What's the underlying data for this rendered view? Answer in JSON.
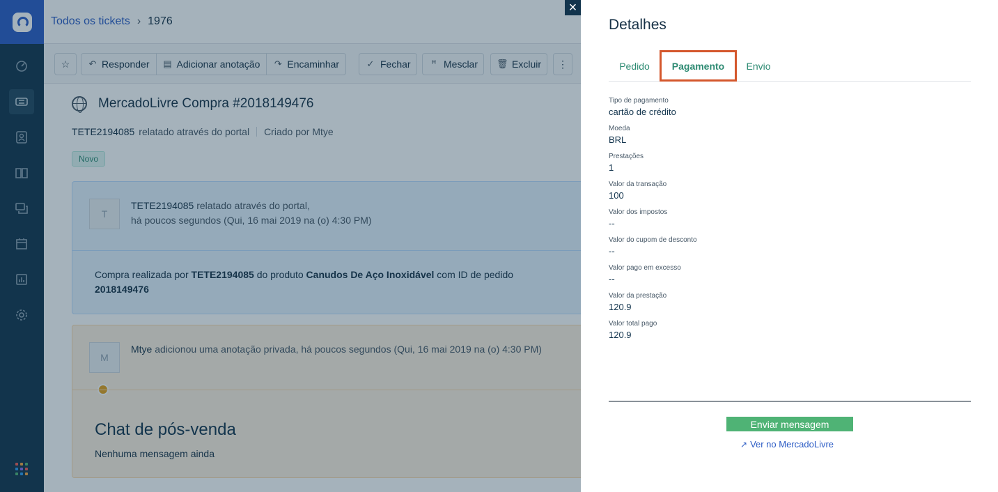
{
  "nav": {
    "items": [
      {
        "icon": "dashboard-icon"
      },
      {
        "icon": "tickets-icon",
        "active": true
      },
      {
        "icon": "contacts-icon"
      },
      {
        "icon": "solutions-icon"
      },
      {
        "icon": "forums-icon"
      },
      {
        "icon": "admin-icon"
      },
      {
        "icon": "reports-icon"
      },
      {
        "icon": "settings-icon"
      }
    ]
  },
  "header": {
    "breadcrumb_link": "Todos os tickets",
    "ticket_number": "1976"
  },
  "toolbar": {
    "star_icon": "star-icon",
    "reply": "Responder",
    "add_note": "Adicionar anotação",
    "forward": "Encaminhar",
    "close": "Fechar",
    "merge": "Mesclar",
    "delete": "Excluir",
    "more": "⋮"
  },
  "ticket": {
    "title": "MercadoLivre Compra #2018149476",
    "requester": "TETE2194085",
    "via": "relatado através do portal",
    "created_by": "Criado por Mtye",
    "status": "Novo"
  },
  "conversation1": {
    "avatar": "T",
    "name": "TETE2194085",
    "via": "relatado através do portal,",
    "time": "há poucos segundos (Qui, 16 mai 2019 na (o) 4:30 PM)",
    "body_prefix": "Compra realizada por ",
    "body_user": "TETE2194085",
    "body_mid": " do produto ",
    "body_product": "Canudos De Aço Inoxidável",
    "body_suffix": " com ID de pedido ",
    "body_order": "2018149476"
  },
  "conversation2": {
    "avatar": "M",
    "name": "Mtye",
    "action": "adicionou uma anotação privada, há poucos segundos (Qui, 16 mai 2019 na (o) 4:30 PM)",
    "chat_title": "Chat de pós-venda",
    "chat_sub": "Nenhuma mensagem ainda"
  },
  "panel": {
    "close": "×",
    "title": "Detalhes",
    "tabs": [
      "Pedido",
      "Pagamento",
      "Envio"
    ],
    "active_tab": "Pagamento",
    "fields": [
      {
        "label": "Tipo de pagamento",
        "value": "cartão de crédito"
      },
      {
        "label": "Moeda",
        "value": "BRL"
      },
      {
        "label": "Prestações",
        "value": "1"
      },
      {
        "label": "Valor da transação",
        "value": "100"
      },
      {
        "label": "Valor dos impostos",
        "value": "--"
      },
      {
        "label": "Valor do cupom de desconto",
        "value": "--"
      },
      {
        "label": "Valor pago em excesso",
        "value": "--"
      },
      {
        "label": "Valor da prestação",
        "value": "120.9"
      },
      {
        "label": "Valor total pago",
        "value": "120.9"
      }
    ],
    "send_button": "Enviar mensagem",
    "external_link": "Ver no MercadoLivre"
  },
  "colors": {
    "nav_bg": "#12344d",
    "brand": "#2c5cc5",
    "accent_green": "#4fb375",
    "tab_highlight": "#d4572c"
  }
}
